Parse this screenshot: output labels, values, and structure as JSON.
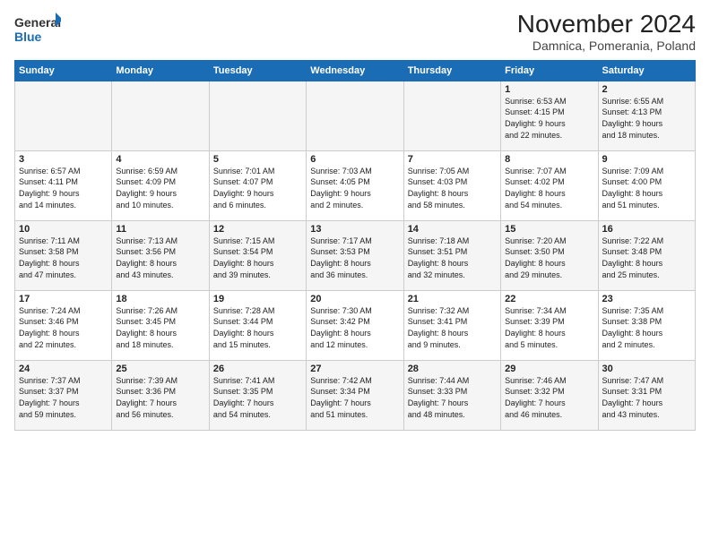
{
  "logo": {
    "line1": "General",
    "line2": "Blue"
  },
  "title": "November 2024",
  "subtitle": "Damnica, Pomerania, Poland",
  "weekdays": [
    "Sunday",
    "Monday",
    "Tuesday",
    "Wednesday",
    "Thursday",
    "Friday",
    "Saturday"
  ],
  "weeks": [
    [
      {
        "day": "",
        "info": ""
      },
      {
        "day": "",
        "info": ""
      },
      {
        "day": "",
        "info": ""
      },
      {
        "day": "",
        "info": ""
      },
      {
        "day": "",
        "info": ""
      },
      {
        "day": "1",
        "info": "Sunrise: 6:53 AM\nSunset: 4:15 PM\nDaylight: 9 hours\nand 22 minutes."
      },
      {
        "day": "2",
        "info": "Sunrise: 6:55 AM\nSunset: 4:13 PM\nDaylight: 9 hours\nand 18 minutes."
      }
    ],
    [
      {
        "day": "3",
        "info": "Sunrise: 6:57 AM\nSunset: 4:11 PM\nDaylight: 9 hours\nand 14 minutes."
      },
      {
        "day": "4",
        "info": "Sunrise: 6:59 AM\nSunset: 4:09 PM\nDaylight: 9 hours\nand 10 minutes."
      },
      {
        "day": "5",
        "info": "Sunrise: 7:01 AM\nSunset: 4:07 PM\nDaylight: 9 hours\nand 6 minutes."
      },
      {
        "day": "6",
        "info": "Sunrise: 7:03 AM\nSunset: 4:05 PM\nDaylight: 9 hours\nand 2 minutes."
      },
      {
        "day": "7",
        "info": "Sunrise: 7:05 AM\nSunset: 4:03 PM\nDaylight: 8 hours\nand 58 minutes."
      },
      {
        "day": "8",
        "info": "Sunrise: 7:07 AM\nSunset: 4:02 PM\nDaylight: 8 hours\nand 54 minutes."
      },
      {
        "day": "9",
        "info": "Sunrise: 7:09 AM\nSunset: 4:00 PM\nDaylight: 8 hours\nand 51 minutes."
      }
    ],
    [
      {
        "day": "10",
        "info": "Sunrise: 7:11 AM\nSunset: 3:58 PM\nDaylight: 8 hours\nand 47 minutes."
      },
      {
        "day": "11",
        "info": "Sunrise: 7:13 AM\nSunset: 3:56 PM\nDaylight: 8 hours\nand 43 minutes."
      },
      {
        "day": "12",
        "info": "Sunrise: 7:15 AM\nSunset: 3:54 PM\nDaylight: 8 hours\nand 39 minutes."
      },
      {
        "day": "13",
        "info": "Sunrise: 7:17 AM\nSunset: 3:53 PM\nDaylight: 8 hours\nand 36 minutes."
      },
      {
        "day": "14",
        "info": "Sunrise: 7:18 AM\nSunset: 3:51 PM\nDaylight: 8 hours\nand 32 minutes."
      },
      {
        "day": "15",
        "info": "Sunrise: 7:20 AM\nSunset: 3:50 PM\nDaylight: 8 hours\nand 29 minutes."
      },
      {
        "day": "16",
        "info": "Sunrise: 7:22 AM\nSunset: 3:48 PM\nDaylight: 8 hours\nand 25 minutes."
      }
    ],
    [
      {
        "day": "17",
        "info": "Sunrise: 7:24 AM\nSunset: 3:46 PM\nDaylight: 8 hours\nand 22 minutes."
      },
      {
        "day": "18",
        "info": "Sunrise: 7:26 AM\nSunset: 3:45 PM\nDaylight: 8 hours\nand 18 minutes."
      },
      {
        "day": "19",
        "info": "Sunrise: 7:28 AM\nSunset: 3:44 PM\nDaylight: 8 hours\nand 15 minutes."
      },
      {
        "day": "20",
        "info": "Sunrise: 7:30 AM\nSunset: 3:42 PM\nDaylight: 8 hours\nand 12 minutes."
      },
      {
        "day": "21",
        "info": "Sunrise: 7:32 AM\nSunset: 3:41 PM\nDaylight: 8 hours\nand 9 minutes."
      },
      {
        "day": "22",
        "info": "Sunrise: 7:34 AM\nSunset: 3:39 PM\nDaylight: 8 hours\nand 5 minutes."
      },
      {
        "day": "23",
        "info": "Sunrise: 7:35 AM\nSunset: 3:38 PM\nDaylight: 8 hours\nand 2 minutes."
      }
    ],
    [
      {
        "day": "24",
        "info": "Sunrise: 7:37 AM\nSunset: 3:37 PM\nDaylight: 7 hours\nand 59 minutes."
      },
      {
        "day": "25",
        "info": "Sunrise: 7:39 AM\nSunset: 3:36 PM\nDaylight: 7 hours\nand 56 minutes."
      },
      {
        "day": "26",
        "info": "Sunrise: 7:41 AM\nSunset: 3:35 PM\nDaylight: 7 hours\nand 54 minutes."
      },
      {
        "day": "27",
        "info": "Sunrise: 7:42 AM\nSunset: 3:34 PM\nDaylight: 7 hours\nand 51 minutes."
      },
      {
        "day": "28",
        "info": "Sunrise: 7:44 AM\nSunset: 3:33 PM\nDaylight: 7 hours\nand 48 minutes."
      },
      {
        "day": "29",
        "info": "Sunrise: 7:46 AM\nSunset: 3:32 PM\nDaylight: 7 hours\nand 46 minutes."
      },
      {
        "day": "30",
        "info": "Sunrise: 7:47 AM\nSunset: 3:31 PM\nDaylight: 7 hours\nand 43 minutes."
      }
    ]
  ]
}
